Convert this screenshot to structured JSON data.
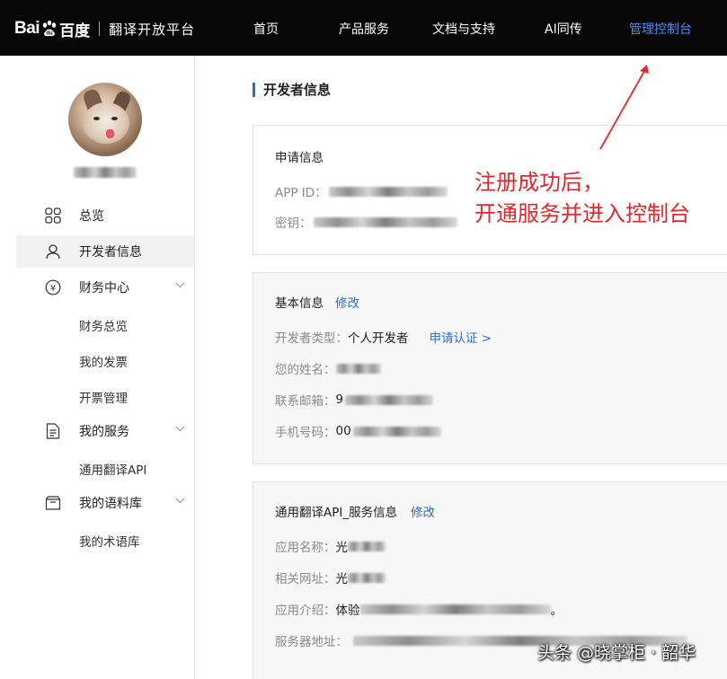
{
  "header": {
    "logo_bai": "Bai",
    "logo_du": "百度",
    "logo_sub": "翻译开放平台",
    "nav": [
      "首页",
      "产品服务",
      "文档与支持",
      "AI同传",
      "管理控制台"
    ]
  },
  "sidebar": {
    "items": [
      {
        "label": "总览",
        "icon": "grid-icon"
      },
      {
        "label": "开发者信息",
        "icon": "user-icon"
      },
      {
        "label": "财务中心",
        "icon": "yen-icon"
      },
      {
        "label": "财务总览"
      },
      {
        "label": "我的发票"
      },
      {
        "label": "开票管理"
      },
      {
        "label": "我的服务",
        "icon": "document-icon"
      },
      {
        "label": "通用翻译API"
      },
      {
        "label": "我的语料库",
        "icon": "inbox-icon"
      },
      {
        "label": "我的术语库"
      }
    ]
  },
  "main": {
    "title": "开发者信息",
    "apply_card": {
      "title": "申请信息",
      "app_id_label": "APP ID：",
      "secret_label": "密钥："
    },
    "basic_card": {
      "title": "基本信息",
      "edit": "修改",
      "dev_type_label": "开发者类型：",
      "dev_type_value": "个人开发者",
      "apply_cert": "申请认证 >",
      "name_label": "您的姓名：",
      "email_label": "联系邮箱：",
      "email_prefix": "9",
      "phone_label": "手机号码：",
      "phone_prefix": "00"
    },
    "service_card": {
      "title": "通用翻译API_服务信息",
      "edit": "修改",
      "app_name_label": "应用名称：",
      "app_name_prefix": "光",
      "url_label": "相关网址：",
      "url_prefix": "光",
      "intro_label": "应用介绍：",
      "intro_prefix": "体验",
      "intro_suffix": "。",
      "server_label": "服务器地址："
    }
  },
  "annotation": {
    "line1": "注册成功后，",
    "line2": "开通服务并进入控制台",
    "color": "#e6262c"
  },
  "watermark": "头条 @晓掌柜 · 韶华"
}
